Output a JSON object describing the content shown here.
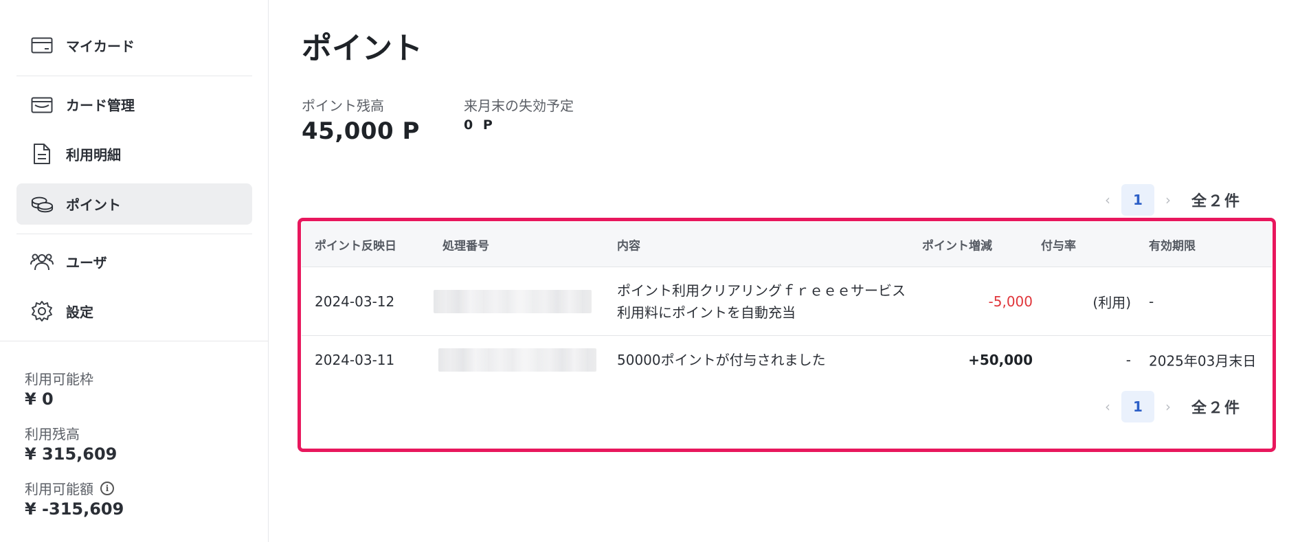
{
  "sidebar": {
    "items": [
      {
        "label": "マイカード",
        "icon": "card-icon"
      },
      {
        "label": "カード管理",
        "icon": "wallet-icon"
      },
      {
        "label": "利用明細",
        "icon": "document-icon"
      },
      {
        "label": "ポイント",
        "icon": "coins-icon"
      },
      {
        "label": "ユーザ",
        "icon": "users-icon"
      },
      {
        "label": "設定",
        "icon": "gear-icon"
      }
    ],
    "limits": [
      {
        "label": "利用可能枠",
        "value": "¥ 0"
      },
      {
        "label": "利用残高",
        "value": "¥ 315,609"
      },
      {
        "label": "利用可能額",
        "value": "¥ -315,609",
        "info_icon": "info-icon"
      }
    ]
  },
  "main": {
    "title": "ポイント",
    "balance": {
      "label": "ポイント残高",
      "value": "45,000 P"
    },
    "expiring": {
      "label": "来月末の失効予定",
      "value": "0 P"
    },
    "pagination": {
      "prev": "‹",
      "page": "1",
      "next": "›",
      "total": "全２件"
    },
    "table": {
      "headers": [
        "ポイント反映日",
        "処理番号",
        "内容",
        "ポイント増減",
        "付与率",
        "有効期限"
      ],
      "rows": [
        {
          "date": "2024-03-12",
          "number": "",
          "content": "ポイント利用クリアリングｆｒｅｅｅサービス利用料にポイントを自動充当",
          "change": "-5,000",
          "rate": "(利用)",
          "expiry": "-"
        },
        {
          "date": "2024-03-11",
          "number": "",
          "content": "50000ポイントが付与されました",
          "change": "+50,000",
          "rate": "-",
          "expiry": "2025年03月末日"
        }
      ]
    }
  },
  "colors": {
    "accent": "#2c5fc7",
    "highlight_border": "#e8175d",
    "negative": "#e0353a",
    "active_nav": "#edeef0"
  }
}
